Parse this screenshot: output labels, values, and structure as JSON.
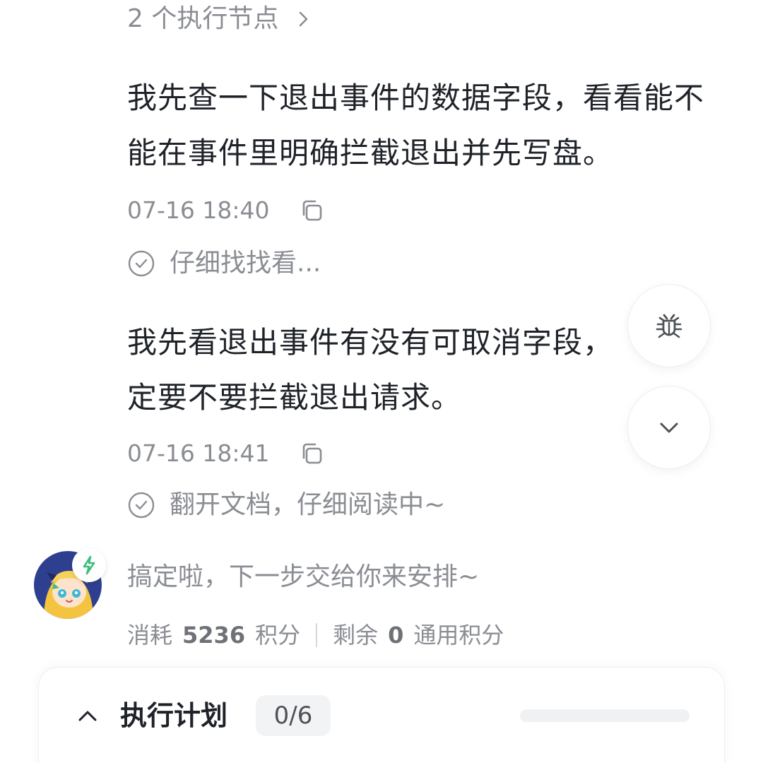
{
  "thread": {
    "exec_nodes_label": "2 个执行节点",
    "messages": [
      {
        "text": "我先查一下退出事件的数据字段，看看能不能在事件里明确拦截退出并先写盘。",
        "time": "07-16 18:40",
        "status": "仔细找找看..."
      },
      {
        "text": "我先看退出事件有没有可取消字段，定要不要拦截退出请求。",
        "time": "07-16 18:41",
        "status": "翻开文档，仔细阅读中~"
      }
    ]
  },
  "assistant": {
    "done_message": "搞定啦，下一步交给你来安排~",
    "credits": {
      "consumed_label": "消耗",
      "consumed_value": "5236",
      "consumed_unit": "积分",
      "remaining_label": "剩余",
      "remaining_value": "0",
      "remaining_unit": "通用积分"
    }
  },
  "plan": {
    "title": "执行计划",
    "progress_text": "0/6",
    "progress_fraction": 0
  },
  "icons": {
    "chevron": "chevron-right-icon",
    "copy": "copy-icon",
    "check": "check-circle-icon",
    "bug": "bug-icon",
    "scroll_down": "chevron-down-icon",
    "collapse": "chevron-up-icon",
    "badge": "lightning-icon"
  },
  "colors": {
    "text_primary": "#1f2329",
    "text_secondary": "#8a8d93",
    "badge_green": "#39c07a",
    "avatar_bg": "#2f3f8f"
  }
}
